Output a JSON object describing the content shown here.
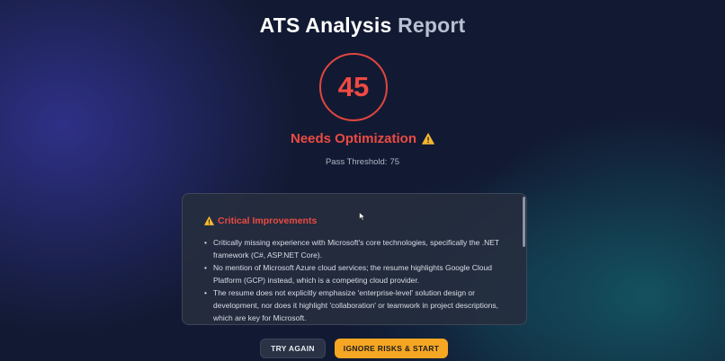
{
  "page": {
    "title_part1": "ATS Analysis",
    "title_part2": "Report"
  },
  "score": {
    "value": "45",
    "status": "Needs Optimization",
    "status_icon": "warning-triangle-icon",
    "threshold_label": "Pass Threshold:",
    "threshold_value": "75"
  },
  "critical": {
    "icon": "warning-triangle-icon",
    "title": "Critical Improvements",
    "items": [
      "Critically missing experience with Microsoft's core technologies, specifically the .NET framework (C#, ASP.NET Core).",
      "No mention of Microsoft Azure cloud services; the resume highlights Google Cloud Platform (GCP) instead, which is a competing cloud provider.",
      "The resume does not explicitly emphasize 'enterprise-level' solution design or development, nor does it highlight 'collaboration' or teamwork in project descriptions, which are key for Microsoft."
    ]
  },
  "actions": {
    "try_again": "TRY AGAIN",
    "ignore_start": "IGNORE RISKS & START"
  },
  "colors": {
    "danger": "#ec4a42",
    "warning": "#f5a623",
    "background": "#121a33"
  }
}
